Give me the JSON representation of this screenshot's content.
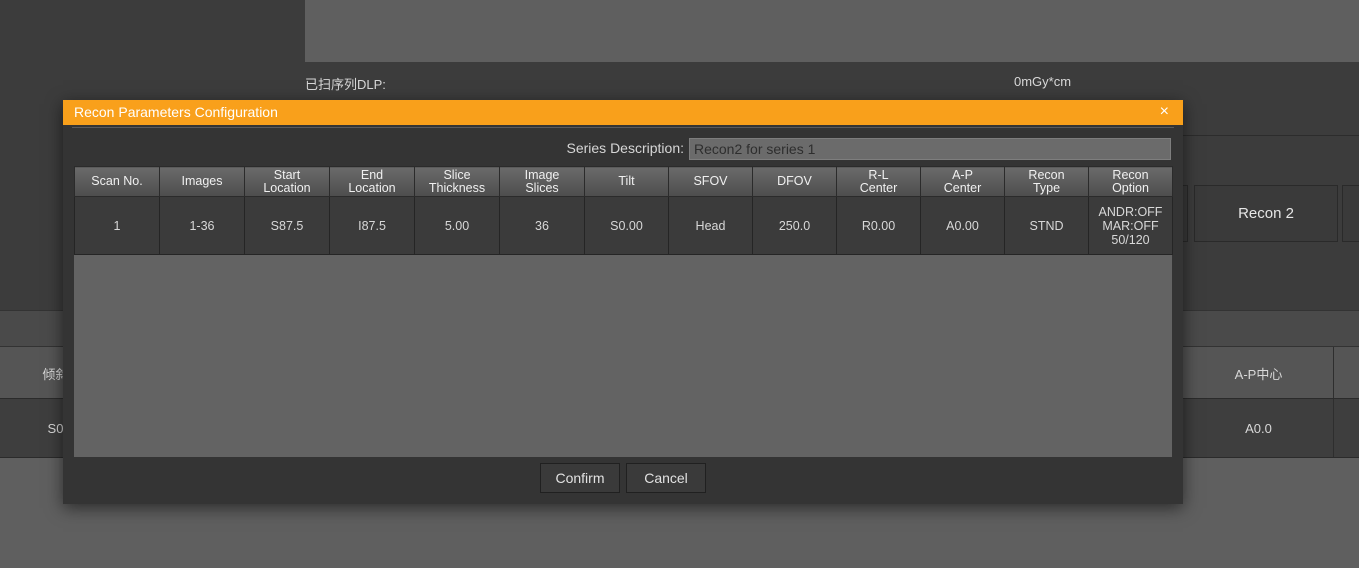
{
  "background": {
    "dlp_label": "已扫序列DLP:",
    "dlp_value": "0mGy*cm",
    "recon_tab_label": "Recon 2",
    "table_header_left": "倾斜",
    "table_header_right": "A-P中心",
    "table_row_left": "S0",
    "table_row_right": "A0.0"
  },
  "dialog": {
    "title": "Recon Parameters Configuration",
    "close_glyph": "×",
    "series_label": "Series Description:",
    "series_value": "Recon2 for series 1",
    "columns": [
      [
        "Scan No.",
        ""
      ],
      [
        "Images",
        ""
      ],
      [
        "Start",
        "Location"
      ],
      [
        "End",
        "Location"
      ],
      [
        "Slice",
        "Thickness"
      ],
      [
        "Image",
        "Slices"
      ],
      [
        "Tilt",
        ""
      ],
      [
        "SFOV",
        ""
      ],
      [
        "DFOV",
        ""
      ],
      [
        "R-L",
        "Center"
      ],
      [
        "A-P",
        "Center"
      ],
      [
        "Recon",
        "Type"
      ],
      [
        "Recon",
        "Option"
      ]
    ],
    "rows": [
      [
        "1",
        "1-36",
        "S87.5",
        "I87.5",
        "5.00",
        "36",
        "S0.00",
        "Head",
        "250.0",
        "R0.00",
        "A0.00",
        "STND",
        [
          "ANDR:OFF",
          "MAR:OFF",
          "50/120"
        ]
      ]
    ],
    "confirm_label": "Confirm",
    "cancel_label": "Cancel"
  },
  "colors": {
    "title_bar": "#f9a01b",
    "dialog_bg": "#343434",
    "grid_area": "#636363"
  }
}
